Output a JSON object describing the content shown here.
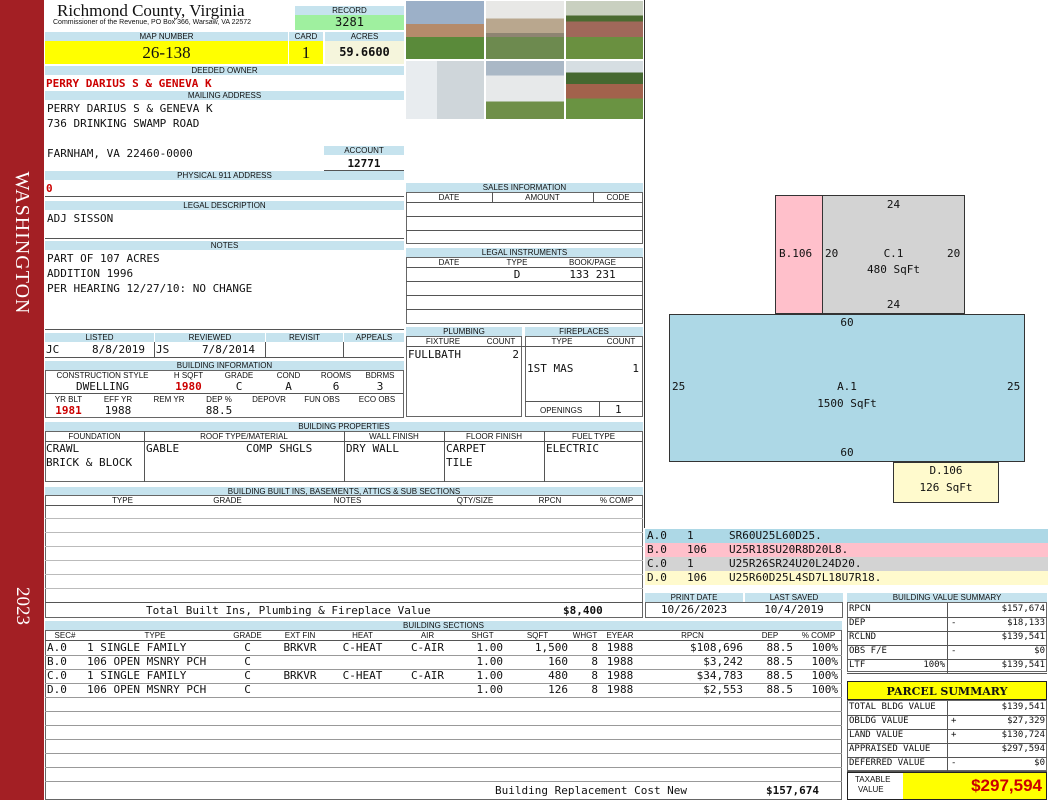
{
  "district": "WASHINGTON",
  "year": "2023",
  "county": "Richmond County, Virginia",
  "commissioner": "Commissioner of the Revenue, PO Box 366, Warsaw, VA 22572",
  "record": {
    "label": "RECORD",
    "value": "3281"
  },
  "map": {
    "label": "MAP NUMBER",
    "value": "26-138"
  },
  "card": {
    "label": "CARD",
    "value": "1"
  },
  "acres": {
    "label": "ACRES",
    "value": "59.6600"
  },
  "owner": {
    "label": "DEEDED OWNER",
    "value": "PERRY DARIUS S & GENEVA K"
  },
  "mailing": {
    "label": "MAILING ADDRESS",
    "line1": "PERRY DARIUS S & GENEVA K",
    "line2": "736 DRINKING SWAMP ROAD",
    "line3": "FARNHAM, VA 22460-0000"
  },
  "account": {
    "label": "ACCOUNT",
    "value": "12771"
  },
  "address911": {
    "label": "PHYSICAL 911 ADDRESS",
    "value": "0"
  },
  "legal": {
    "label": "LEGAL DESCRIPTION",
    "value": "ADJ SISSON"
  },
  "notes": {
    "label": "NOTES",
    "lines": [
      "PART OF 107 ACRES",
      "ADDITION 1996",
      "PER HEARING 12/27/10: NO CHANGE"
    ]
  },
  "listing": {
    "h_listed": "LISTED",
    "h_reviewed": "REVIEWED",
    "h_revisit": "REVISIT",
    "h_appeals": "APPEALS",
    "l_by": "JC",
    "l_date": "8/8/2019",
    "r_by": "JS",
    "r_date": "7/8/2014"
  },
  "bldg_info": {
    "label": "BUILDING INFORMATION",
    "h": [
      "CONSTRUCTION STYLE",
      "H SQFT",
      "GRADE",
      "COND",
      "ROOMS",
      "BDRMS"
    ],
    "v": [
      "DWELLING",
      "1980",
      "C",
      "A",
      "6",
      "3"
    ],
    "h2": [
      "YR BLT",
      "EFF YR",
      "REM YR",
      "DEP %",
      "DEPOVR",
      "FUN OBS",
      "ECO OBS"
    ],
    "v2": [
      "1981",
      "1988",
      "",
      "88.5",
      "",
      "",
      ""
    ]
  },
  "sales": {
    "label": "SALES INFORMATION",
    "h": [
      "DATE",
      "AMOUNT",
      "CODE"
    ]
  },
  "legal_inst": {
    "label": "LEGAL INSTRUMENTS",
    "h": [
      "DATE",
      "TYPE",
      "BOOK/PAGE"
    ],
    "type": "D",
    "book": "133 231"
  },
  "plumbing": {
    "label": "PLUMBING",
    "h": [
      "FIXTURE",
      "COUNT"
    ],
    "fixture": "FULLBATH",
    "count": "2"
  },
  "fireplaces": {
    "label": "FIREPLACES",
    "h": [
      "TYPE",
      "COUNT"
    ],
    "type": "1ST MAS",
    "count": "1",
    "openings_label": "OPENINGS",
    "openings": "1"
  },
  "props": {
    "label": "BUILDING PROPERTIES",
    "h": [
      "FOUNDATION",
      "ROOF TYPE/MATERIAL",
      "WALL FINISH",
      "FLOOR FINISH",
      "FUEL TYPE"
    ],
    "foundation1": "CRAWL",
    "foundation2": "BRICK & BLOCK",
    "roof_type": "GABLE",
    "roof_mat": "COMP SHGLS",
    "wall": "DRY WALL",
    "floor1": "CARPET",
    "floor2": "TILE",
    "fuel": "ELECTRIC"
  },
  "builtins": {
    "label": "BUILDING BUILT INS, BASEMENTS, ATTICS & SUB SECTIONS",
    "h": [
      "TYPE",
      "GRADE",
      "NOTES",
      "QTY/SIZE",
      "RPCN",
      "% COMP"
    ],
    "total_label": "Total Built Ins, Plumbing & Fireplace Value",
    "total": "$8,400"
  },
  "dates": {
    "print_label": "PRINT DATE",
    "print": "10/26/2023",
    "saved_label": "LAST SAVED",
    "saved": "10/4/2019"
  },
  "sketch": {
    "A": {
      "name": "A.1",
      "area": "1500 SqFt",
      "top": "60",
      "bottom": "60",
      "left": "25",
      "right": "25"
    },
    "B": {
      "name": "B.106"
    },
    "C": {
      "name": "C.1",
      "area": "480 SqFt",
      "top": "24",
      "bottom": "24",
      "left": "20",
      "right": "20"
    },
    "D": {
      "name": "D.106",
      "area": "126 SqFt"
    }
  },
  "codes": [
    {
      "sec": "A.0",
      "type": "1",
      "code": "SR60U25L60D25.",
      "color": "#add8e6"
    },
    {
      "sec": "B.0",
      "type": "106",
      "code": "U25R18SU20R8D20L8.",
      "color": "#ffc0cb"
    },
    {
      "sec": "C.0",
      "type": "1",
      "code": "U25R26SR24U20L24D20.",
      "color": "#d3d3d3"
    },
    {
      "sec": "D.0",
      "type": "106",
      "code": "U25R60D25L4SD7L18U7R18.",
      "color": "#fffacd"
    }
  ],
  "sections": {
    "label": "BUILDING SECTIONS",
    "h": [
      "SEC#",
      "TYPE",
      "GRADE",
      "EXT FIN",
      "HEAT",
      "AIR",
      "SHGT",
      "SQFT",
      "WHGT",
      "EYEAR",
      "RPCN",
      "DEP",
      "% COMP"
    ],
    "rows": [
      [
        "A.0",
        "1 SINGLE FAMILY",
        "C",
        "BRKVR",
        "C-HEAT",
        "C-AIR",
        "1.00",
        "1,500",
        "8",
        "1988",
        "$108,696",
        "88.5",
        "100%"
      ],
      [
        "B.0",
        "106 OPEN MSNRY PCH",
        "C",
        "",
        "",
        "",
        "1.00",
        "160",
        "8",
        "1988",
        "$3,242",
        "88.5",
        "100%"
      ],
      [
        "C.0",
        "1 SINGLE FAMILY",
        "C",
        "BRKVR",
        "C-HEAT",
        "C-AIR",
        "1.00",
        "480",
        "8",
        "1988",
        "$34,783",
        "88.5",
        "100%"
      ],
      [
        "D.0",
        "106 OPEN MSNRY PCH",
        "C",
        "",
        "",
        "",
        "1.00",
        "126",
        "8",
        "1988",
        "$2,553",
        "88.5",
        "100%"
      ]
    ],
    "total_label": "Building Replacement Cost New",
    "total": "$157,674"
  },
  "bvs": {
    "label": "BUILDING VALUE SUMMARY",
    "rows": [
      {
        "k": "RPCN",
        "s": "",
        "v": "$157,674"
      },
      {
        "k": "DEP",
        "s": "-",
        "v": "$18,133"
      },
      {
        "k": "RCLND",
        "s": "",
        "v": "$139,541"
      },
      {
        "k": "OBS F/E",
        "s": "-",
        "v": "$0"
      },
      {
        "k": "LTF",
        "pct": "100%",
        "s": "",
        "v": "$139,541"
      }
    ]
  },
  "parcel": {
    "label": "PARCEL SUMMARY",
    "rows": [
      {
        "k": "TOTAL BLDG VALUE",
        "s": "",
        "v": "$139,541"
      },
      {
        "k": "OBLDG VALUE",
        "s": "+",
        "v": "$27,329"
      },
      {
        "k": "LAND VALUE",
        "s": "+",
        "v": "$130,724"
      },
      {
        "k": "APPRAISED VALUE",
        "s": "",
        "v": "$297,594"
      },
      {
        "k": "DEFERRED VALUE",
        "s": "-",
        "v": "$0"
      }
    ],
    "taxable_label1": "TAXABLE",
    "taxable_label2": "VALUE",
    "taxable": "$297,594"
  }
}
